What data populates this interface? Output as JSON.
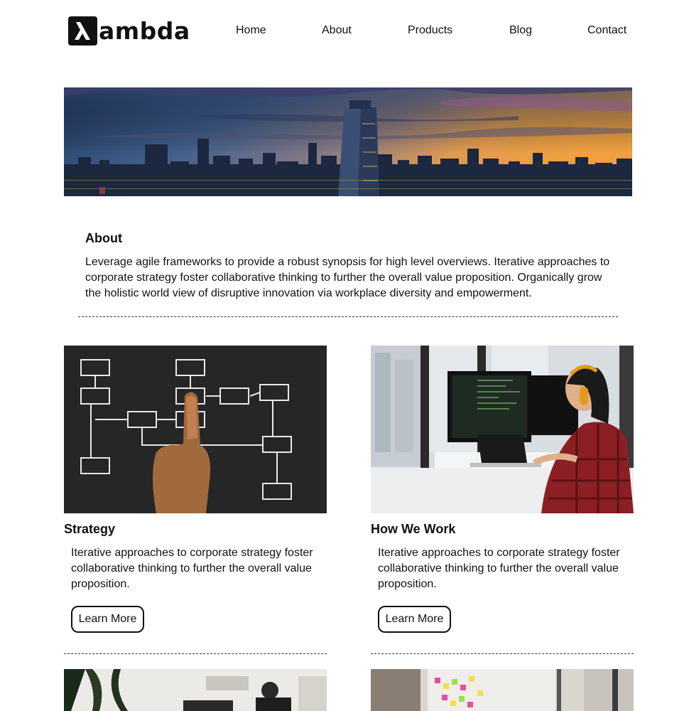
{
  "brand": {
    "logo_glyph": "λ",
    "logo_text": "ambda"
  },
  "nav": [
    "Home",
    "About",
    "Products",
    "Blog",
    "Contact"
  ],
  "about": {
    "title": "About",
    "text": "Leverage agile frameworks to provide a robust synopsis for high level overviews. Iterative approaches to corporate strategy foster collaborative thinking to further the overall value proposition. Organically grow the holistic world view of disruptive innovation via workplace diversity and empowerment."
  },
  "cards": [
    {
      "title": "Strategy",
      "text": "Iterative approaches to corporate strategy foster collaborative thinking to further the overall value proposition.",
      "button": "Learn More"
    },
    {
      "title": "How We Work",
      "text": "Iterative approaches to corporate strategy foster collaborative thinking to further the overall value proposition.",
      "button": "Learn More"
    }
  ],
  "colors": {
    "text": "#111111",
    "background": "#ffffff"
  }
}
